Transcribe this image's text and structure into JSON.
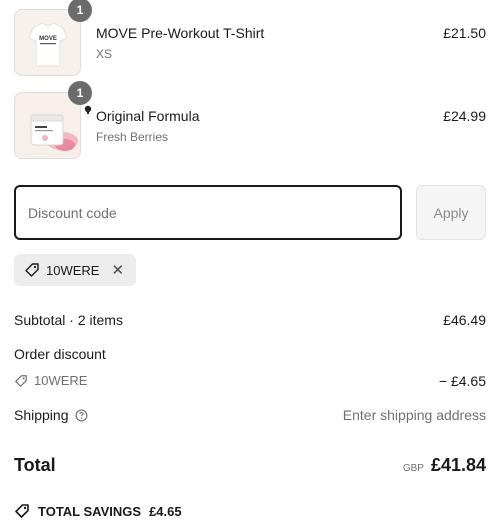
{
  "items": [
    {
      "title": "MOVE Pre-Workout T-Shirt",
      "variant": "XS",
      "price": "£21.50",
      "quantity": "1",
      "thumb_text": "MOVE"
    },
    {
      "title": "Original Formula",
      "variant": "Fresh Berries",
      "price": "£24.99",
      "quantity": "1"
    }
  ],
  "discount": {
    "placeholder": "Discount code",
    "apply_label": "Apply",
    "applied_code": "10WERE"
  },
  "summary": {
    "subtotal_label": "Subtotal · 2 items",
    "subtotal_value": "£46.49",
    "order_discount_label": "Order discount",
    "discount_code": "10WERE",
    "discount_value": "− £4.65",
    "shipping_label": "Shipping",
    "shipping_value": "Enter shipping address",
    "total_label": "Total",
    "currency": "GBP",
    "total_value": "£41.84",
    "savings_label": "TOTAL SAVINGS",
    "savings_value": "£4.65"
  },
  "colors": {
    "text": "#1a1a1a",
    "muted": "#707070",
    "badge": "#6b6b6b",
    "chip": "#ececec"
  }
}
